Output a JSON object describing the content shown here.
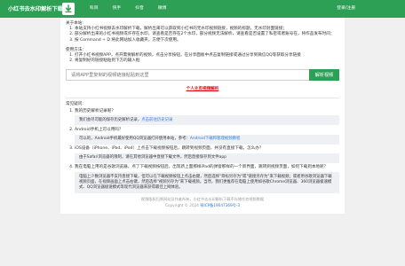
{
  "header": {
    "brand": "小红书去水印解析下载",
    "nav": [
      "科目",
      "快手",
      "抖音",
      "微博"
    ],
    "login": "登录/注册"
  },
  "intro": {
    "title": "关于本站:",
    "items": [
      "本站支持小红书视频去水印解析下载，解析出来可以获取到小红书的无水印视频链接，视频的标题，无水印封面链接；",
      "部分解析出来的小红书视频或许存在水印，请查看是否存在2个水印，部分视频无法解析，请查看是否设置了私密或者账号在，将作品发布时间；",
      "按 Command + D 将此网站加入收藏夹，方便下次使用。"
    ]
  },
  "usage": {
    "title": "使用方法:",
    "items": [
      "打开小红书视频APP，点开需要解析的视频，点击分享按钮，在分享面板中点击复制链接或通过分享到微信QQ等获取分享链接",
      "将复制好的链接粘贴到下方的输入框"
    ]
  },
  "search": {
    "placeholder": "请将APP里复制的视频链接粘贴到这里",
    "button": "解析视频"
  },
  "tutorial_link": "个人主页视频解析",
  "faq": {
    "title": "常见疑问:",
    "items": [
      {
        "q": "我的历史解析记录呢？",
        "a": "我们会尽可能的保存历史解析记录，",
        "link": "点击前往历史记录"
      },
      {
        "q": "Android手机上可以用吗？",
        "a": "可以的，Android手机最好使用QQ浏览器打开使用本站，参考：",
        "link": "Android下载和管理视频教程"
      },
      {
        "q": "iOS设备（iPhone、iPad、iPod）上点击下载视频按钮后，跳转到视频页面，并没有直接下载，怎么办？",
        "a": "由于Safari浏览器的限制，请在其他浏览器中直接下载文件，然后直接保存到文件app",
        "link": ""
      },
      {
        "q": "我在电脑上用的是谷歌浏览器，点了下载视频按钮后，出现新上面那样iPad的弹窗那样的一个新界面，跳转到视频页面，如何下载到本地呢？",
        "a": "电脑上少数浏览器不支持直接下载，但可以在下载视频按钮上点击右键，然后选择\"目标另存为\"或\"链接另存为\"来下载视频；或者用谷歌浏览器下载视频页面，在视频画面上点击右键，然后选择\"视频另存为\"来下载视频。当然，我们更推荐在电脑上使用如谷歌Chrome浏览器、360浏览器极速模式、QQ浏览器极速模式等现代浏览器来获得最佳上网体验。",
        "link": ""
      }
    ]
  },
  "footer": {
    "line1": "视频版权归原网站及作者所有，小红书去水印解析下载不存储任何视频数据",
    "line2_prefix": "Copyright © 2024",
    "line2_link": "鄂ICP备19047369号-3"
  },
  "colors": {
    "brand_green": "#2ea055",
    "link_blue": "#2b7cd3",
    "tutorial_red": "#e60012"
  }
}
